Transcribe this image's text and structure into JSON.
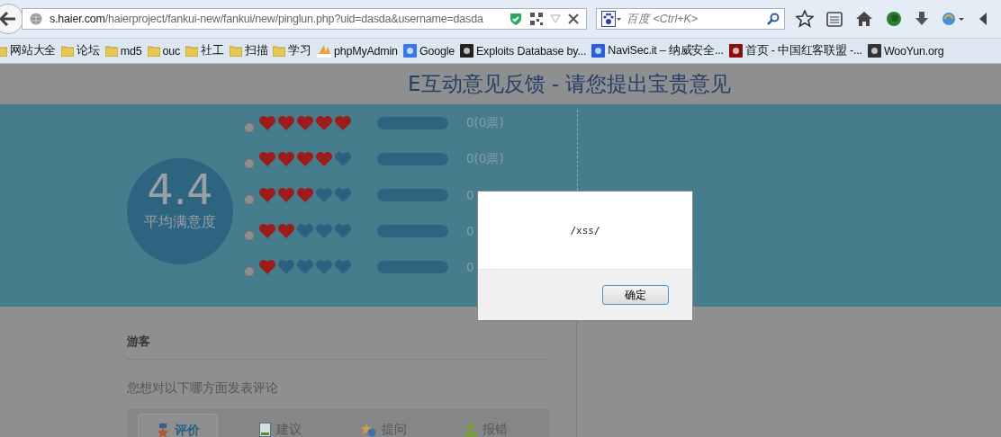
{
  "browser": {
    "url_host": "s.haier.com",
    "url_path": "/haierproject/fankui-new/fankui/new/pinglun.php?uid=dasda&username=dasda",
    "search_placeholder": "百度 <Ctrl+K>"
  },
  "bookmarks": [
    {
      "label": "网站大全",
      "kind": "folder"
    },
    {
      "label": "论坛",
      "kind": "folder"
    },
    {
      "label": "md5",
      "kind": "folder"
    },
    {
      "label": "ouc",
      "kind": "folder"
    },
    {
      "label": "社工",
      "kind": "folder"
    },
    {
      "label": "扫描",
      "kind": "folder"
    },
    {
      "label": "学习",
      "kind": "folder"
    },
    {
      "label": "phpMyAdmin",
      "kind": "pma"
    },
    {
      "label": "Google",
      "kind": "google"
    },
    {
      "label": "Exploits Database by...",
      "kind": "exploit"
    },
    {
      "label": "NaviSec.it – 纳威安全...",
      "kind": "navisec"
    },
    {
      "label": "首页 - 中国红客联盟 -...",
      "kind": "huc"
    },
    {
      "label": "WooYun.org",
      "kind": "wooyun"
    }
  ],
  "page": {
    "title": "E互动意见反馈 - 请您提出宝贵意见",
    "average": {
      "score": "4.4",
      "label": "平均满意度"
    },
    "ratings": [
      {
        "stars": 5,
        "selected": false,
        "level": 0,
        "count": "0(0票)"
      },
      {
        "stars": 4,
        "selected": false,
        "level": 0,
        "count": "0(0票)"
      },
      {
        "stars": 3,
        "selected": false,
        "level": 0,
        "count": "0"
      },
      {
        "stars": 2,
        "selected": false,
        "level": 0,
        "count": "0"
      },
      {
        "stars": 1,
        "selected": false,
        "level": 0,
        "count": "0"
      }
    ],
    "user": "游客",
    "prompt": "您想对以下哪方面发表评论",
    "tabs": [
      {
        "label": "评价",
        "kind": "medal",
        "selected": true
      },
      {
        "label": "建议",
        "kind": "doc",
        "selected": false
      },
      {
        "label": "提问",
        "kind": "question",
        "selected": false
      },
      {
        "label": "报错",
        "kind": "person",
        "selected": false
      }
    ]
  },
  "dialog": {
    "message": "/xss/",
    "button": "确定"
  }
}
